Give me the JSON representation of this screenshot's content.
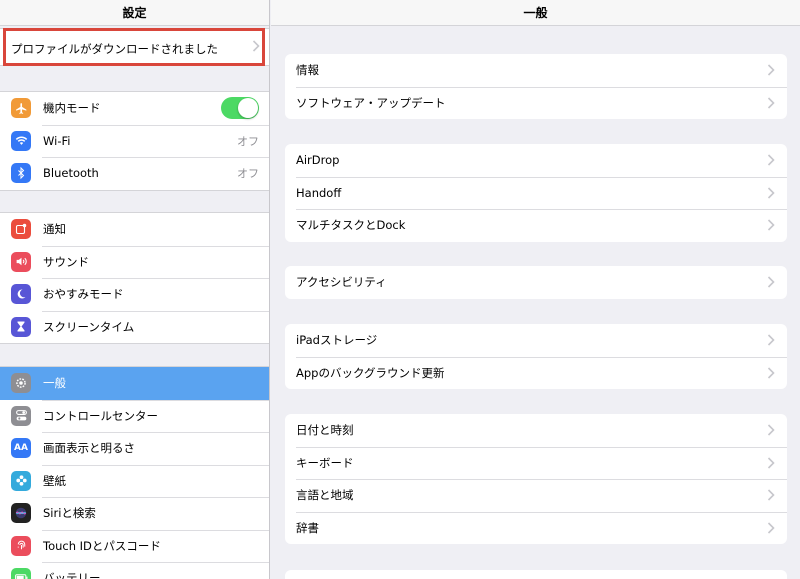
{
  "sidebar": {
    "title": "設定",
    "profile_banner": "プロファイルがダウンロードされました",
    "groups": [
      [
        {
          "label": "機内モード",
          "icon": "airplane-icon",
          "color": "#f19a37",
          "toggle": true
        },
        {
          "label": "Wi-Fi",
          "icon": "wifi-icon",
          "color": "#3478f6",
          "value": "オフ"
        },
        {
          "label": "Bluetooth",
          "icon": "bluetooth-icon",
          "color": "#3478f6",
          "value": "オフ"
        }
      ],
      [
        {
          "label": "通知",
          "icon": "notifications-icon",
          "color": "#eb4d3d"
        },
        {
          "label": "サウンド",
          "icon": "sound-icon",
          "color": "#eb4d5c"
        },
        {
          "label": "おやすみモード",
          "icon": "moon-icon",
          "color": "#5856d6"
        },
        {
          "label": "スクリーンタイム",
          "icon": "hourglass-icon",
          "color": "#5856d6"
        }
      ],
      [
        {
          "label": "一般",
          "icon": "gear-icon",
          "color": "#8e8e93",
          "selected": true
        },
        {
          "label": "コントロールセンター",
          "icon": "switches-icon",
          "color": "#8e8e93"
        },
        {
          "label": "画面表示と明るさ",
          "icon": "text-size-icon",
          "color": "#3478f6"
        },
        {
          "label": "壁紙",
          "icon": "flower-icon",
          "color": "#34aadc"
        },
        {
          "label": "Siriと検索",
          "icon": "siri-icon",
          "color": "#222222"
        },
        {
          "label": "Touch IDとパスコード",
          "icon": "fingerprint-icon",
          "color": "#eb4d5c"
        },
        {
          "label": "バッテリー",
          "icon": "battery-icon",
          "color": "#4cd964"
        }
      ]
    ]
  },
  "main": {
    "title": "一般",
    "groups": [
      [
        "情報",
        "ソフトウェア・アップデート"
      ],
      [
        "AirDrop",
        "Handoff",
        "マルチタスクとDock"
      ],
      [
        "アクセシビリティ"
      ],
      [
        "iPadストレージ",
        "Appのバックグラウンド更新"
      ],
      [
        "日付と時刻",
        "キーボード",
        "言語と地域",
        "辞書"
      ],
      [
        ""
      ]
    ]
  },
  "colors": {
    "selected": "#5aa3f0",
    "highlight_border": "#d9463b",
    "toggle_on": "#4cd964"
  }
}
